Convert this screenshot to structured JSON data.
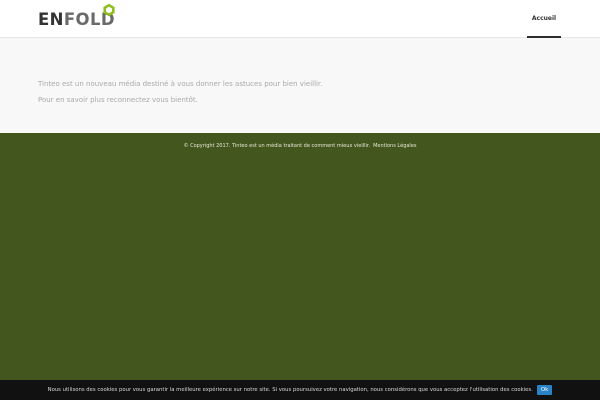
{
  "header": {
    "logo": {
      "text_en": "EN",
      "text_fold": "FOLD",
      "icon": "hexagon-logo-icon",
      "accent_color": "#8fbf21"
    },
    "nav": {
      "items": [
        {
          "label": "Accueil",
          "active": true
        }
      ]
    }
  },
  "main": {
    "paragraphs": [
      "Tinteo est un nouveau média destiné à vous donner les astuces pour bien vieillir.",
      "Pour en savoir plus reconnectez vous bientôt."
    ]
  },
  "footer": {
    "copyright": "© Copyright 2017. Tinteo est un média traitant de comment mieux vieillir.",
    "legal_link": "Mentions Légales",
    "background_color": "#43561e"
  },
  "cookie_bar": {
    "message": "Nous utilisons des cookies pour vous garantir la meilleure expérience sur notre site. Si vous poursuivez votre navigation, nous considérons que vous acceptez l'utilisation des cookies.",
    "ok_label": "Ok",
    "button_color": "#2a82c7"
  }
}
